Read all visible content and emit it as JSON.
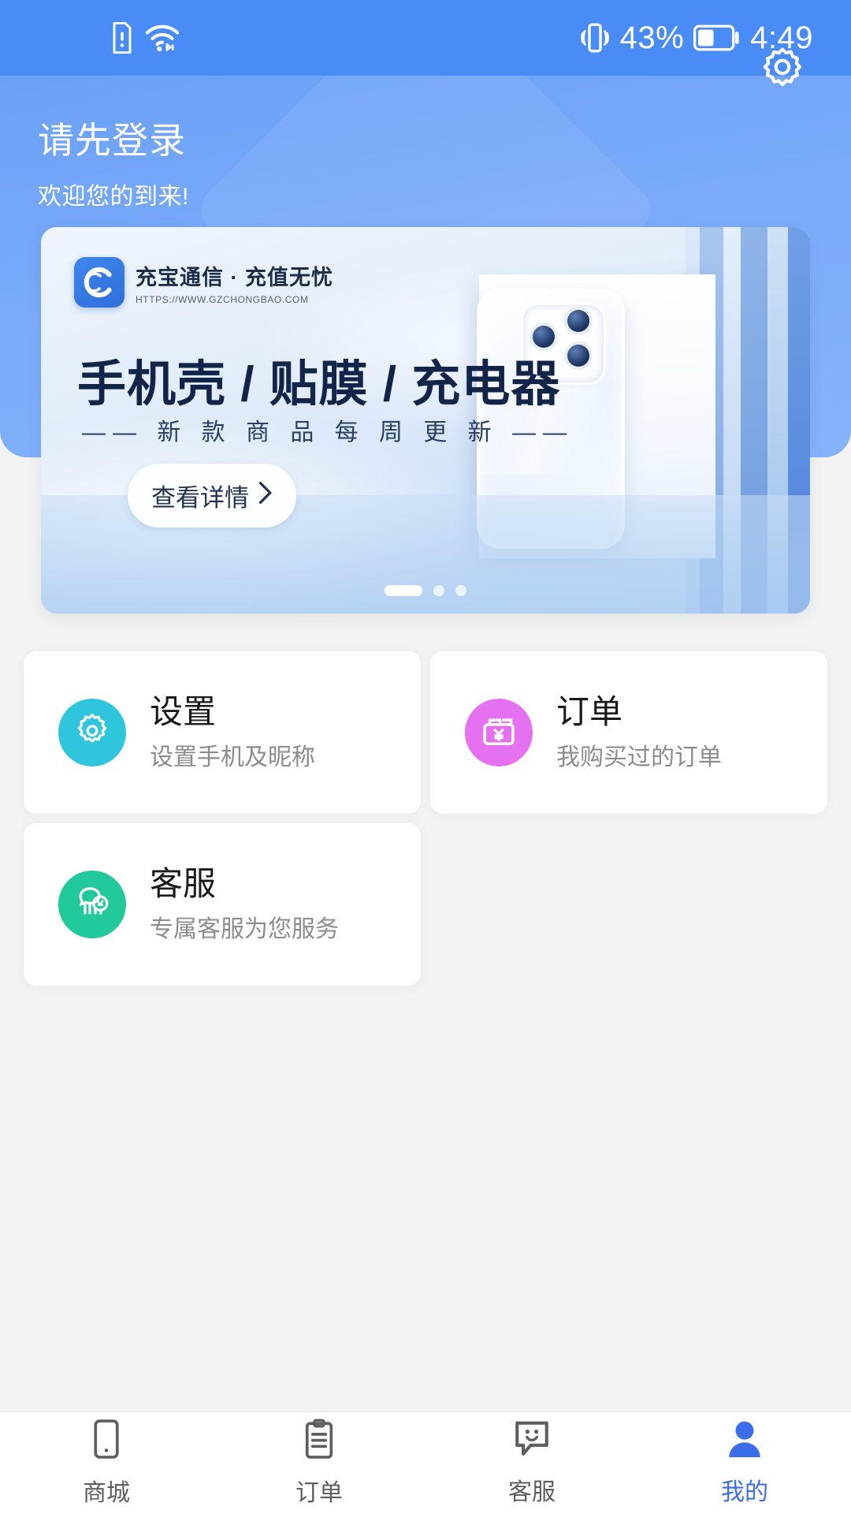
{
  "status_bar": {
    "left_icons": [
      "sim-alert-icon",
      "wifi-icon"
    ],
    "vibrate_icon": "vibrate-icon",
    "battery_percent": "43%",
    "battery_level": 43,
    "battery_icon": "battery-icon",
    "time": "4:49"
  },
  "header": {
    "title": "请先登录",
    "subtitle": "欢迎您的到来!",
    "settings_icon": "gear-icon",
    "bg_color": "#7aaaf9"
  },
  "banner": {
    "logo_letter": "C",
    "brand": "充宝通信 · 充值无忧",
    "url": "HTTPS://WWW.GZCHONGBAO.COM",
    "headline_parts": [
      "手机壳",
      "/",
      "贴膜",
      "/",
      "充电器"
    ],
    "headline": "手机壳 / 贴膜 / 充电器",
    "subhead": "—— 新 款 商 品  每 周 更 新 ——",
    "cta_label": "查看详情",
    "cta_icon": "chevron-right-icon",
    "dots_total": 3,
    "dots_active": 1
  },
  "cards": [
    {
      "icon": "gear-icon",
      "icon_color": "#2ec5dd",
      "title": "设置",
      "subtitle": "设置手机及昵称"
    },
    {
      "icon": "wallet-yen-icon",
      "icon_color": "#e570f0",
      "title": "订单",
      "subtitle": "我购买过的订单"
    },
    {
      "icon": "mascot-icon",
      "icon_color": "#22c99a",
      "title": "客服",
      "subtitle": "专属客服为您服务"
    }
  ],
  "tabbar": {
    "active_color": "#3a6ee8",
    "inactive_color": "#5e5e5e",
    "items": [
      {
        "label": "商城",
        "icon": "phone-icon",
        "active": false
      },
      {
        "label": "订单",
        "icon": "clipboard-icon",
        "active": false
      },
      {
        "label": "客服",
        "icon": "chat-smile-icon",
        "active": false
      },
      {
        "label": "我的",
        "icon": "person-icon",
        "active": true
      }
    ]
  }
}
